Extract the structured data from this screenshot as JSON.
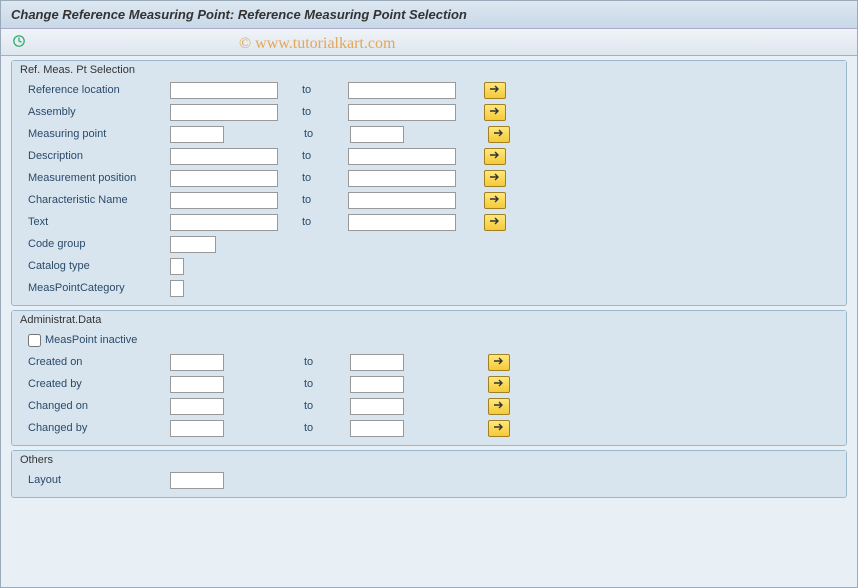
{
  "title": "Change Reference Measuring Point: Reference Measuring Point Selection",
  "watermark": "© www.tutorialkart.com",
  "to_label": "to",
  "group1": {
    "title": "Ref. Meas. Pt Selection",
    "rows": {
      "ref_loc": "Reference location",
      "assembly": "Assembly",
      "meas_point": "Measuring point",
      "description": "Description",
      "meas_position": "Measurement position",
      "char_name": "Characteristic Name",
      "text": "Text",
      "code_group": "Code group",
      "catalog_type": "Catalog type",
      "measpoint_cat": "MeasPointCategory"
    }
  },
  "group2": {
    "title": "Administrat.Data",
    "checkbox": "MeasPoint inactive",
    "rows": {
      "created_on": "Created on",
      "created_by": "Created by",
      "changed_on": "Changed on",
      "changed_by": "Changed by"
    }
  },
  "group3": {
    "title": "Others",
    "rows": {
      "layout": "Layout"
    }
  }
}
